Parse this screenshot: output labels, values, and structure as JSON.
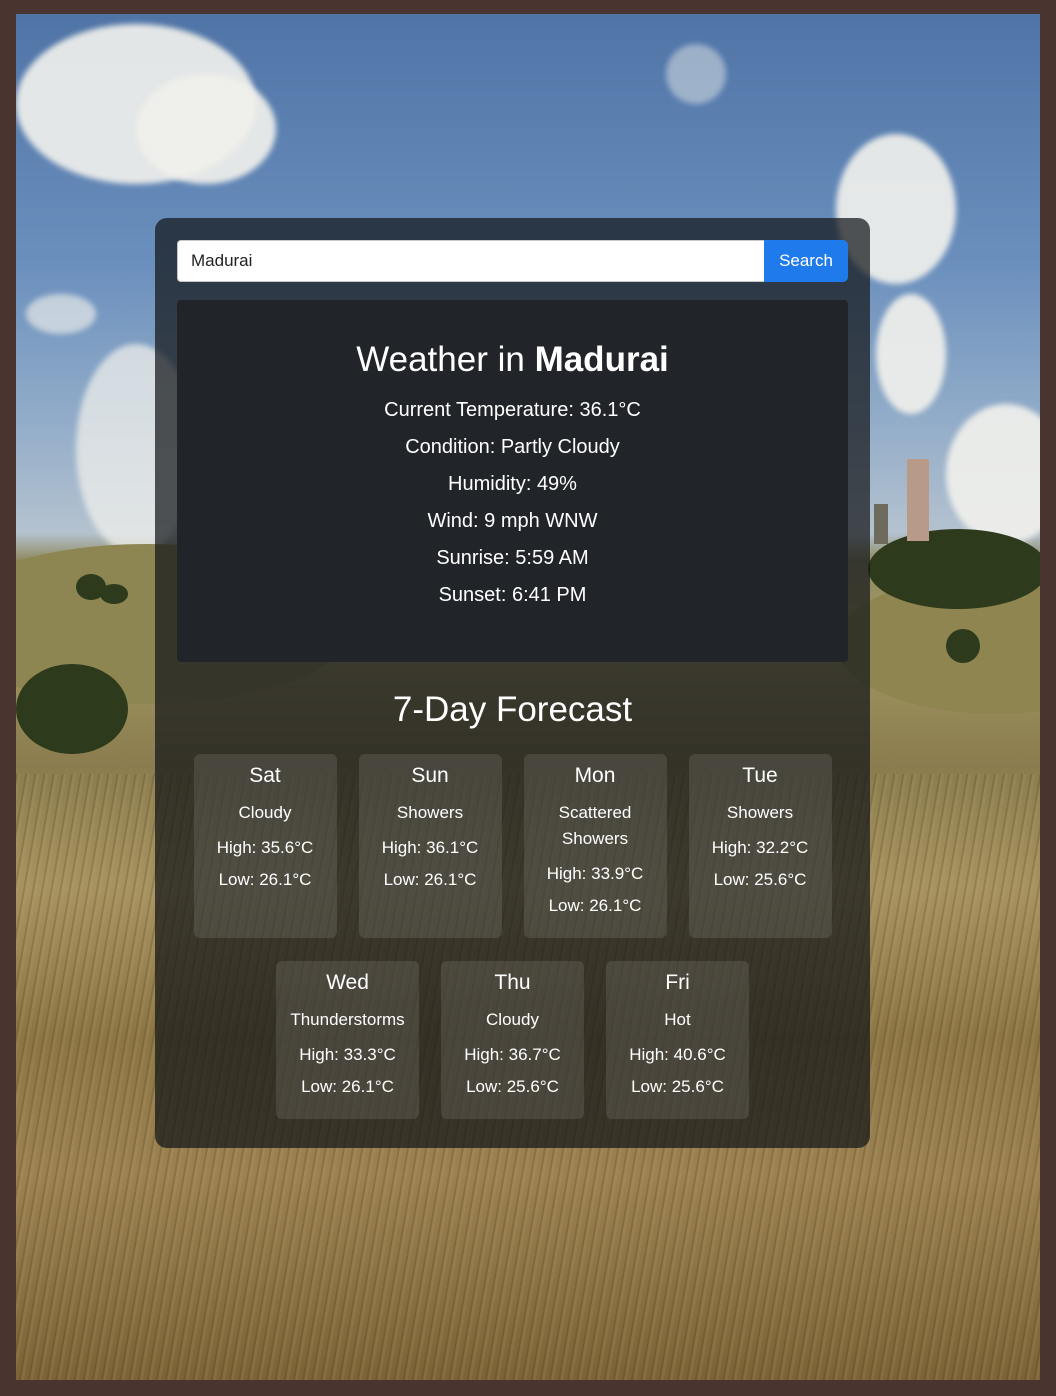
{
  "search": {
    "value": "Madurai",
    "button_label": "Search"
  },
  "current": {
    "title_prefix": "Weather in",
    "city": "Madurai",
    "temperature": "Current Temperature: 36.1°C",
    "condition": "Condition: Partly Cloudy",
    "humidity": "Humidity: 49%",
    "wind": "Wind: 9 mph WNW",
    "sunrise": "Sunrise: 5:59 AM",
    "sunset": "Sunset: 6:41 PM"
  },
  "forecast": {
    "title": "7-Day Forecast",
    "days": [
      {
        "name": "Sat",
        "condition": "Cloudy",
        "high": "High: 35.6°C",
        "low": "Low: 26.1°C"
      },
      {
        "name": "Sun",
        "condition": "Showers",
        "high": "High: 36.1°C",
        "low": "Low: 26.1°C"
      },
      {
        "name": "Mon",
        "condition": "Scattered Showers",
        "high": "High: 33.9°C",
        "low": "Low: 26.1°C"
      },
      {
        "name": "Tue",
        "condition": "Showers",
        "high": "High: 32.2°C",
        "low": "Low: 25.6°C"
      },
      {
        "name": "Wed",
        "condition": "Thunderstorms",
        "high": "High: 33.3°C",
        "low": "Low: 26.1°C"
      },
      {
        "name": "Thu",
        "condition": "Cloudy",
        "high": "High: 36.7°C",
        "low": "Low: 25.6°C"
      },
      {
        "name": "Fri",
        "condition": "Hot",
        "high": "High: 40.6°C",
        "low": "Low: 25.6°C"
      }
    ]
  }
}
